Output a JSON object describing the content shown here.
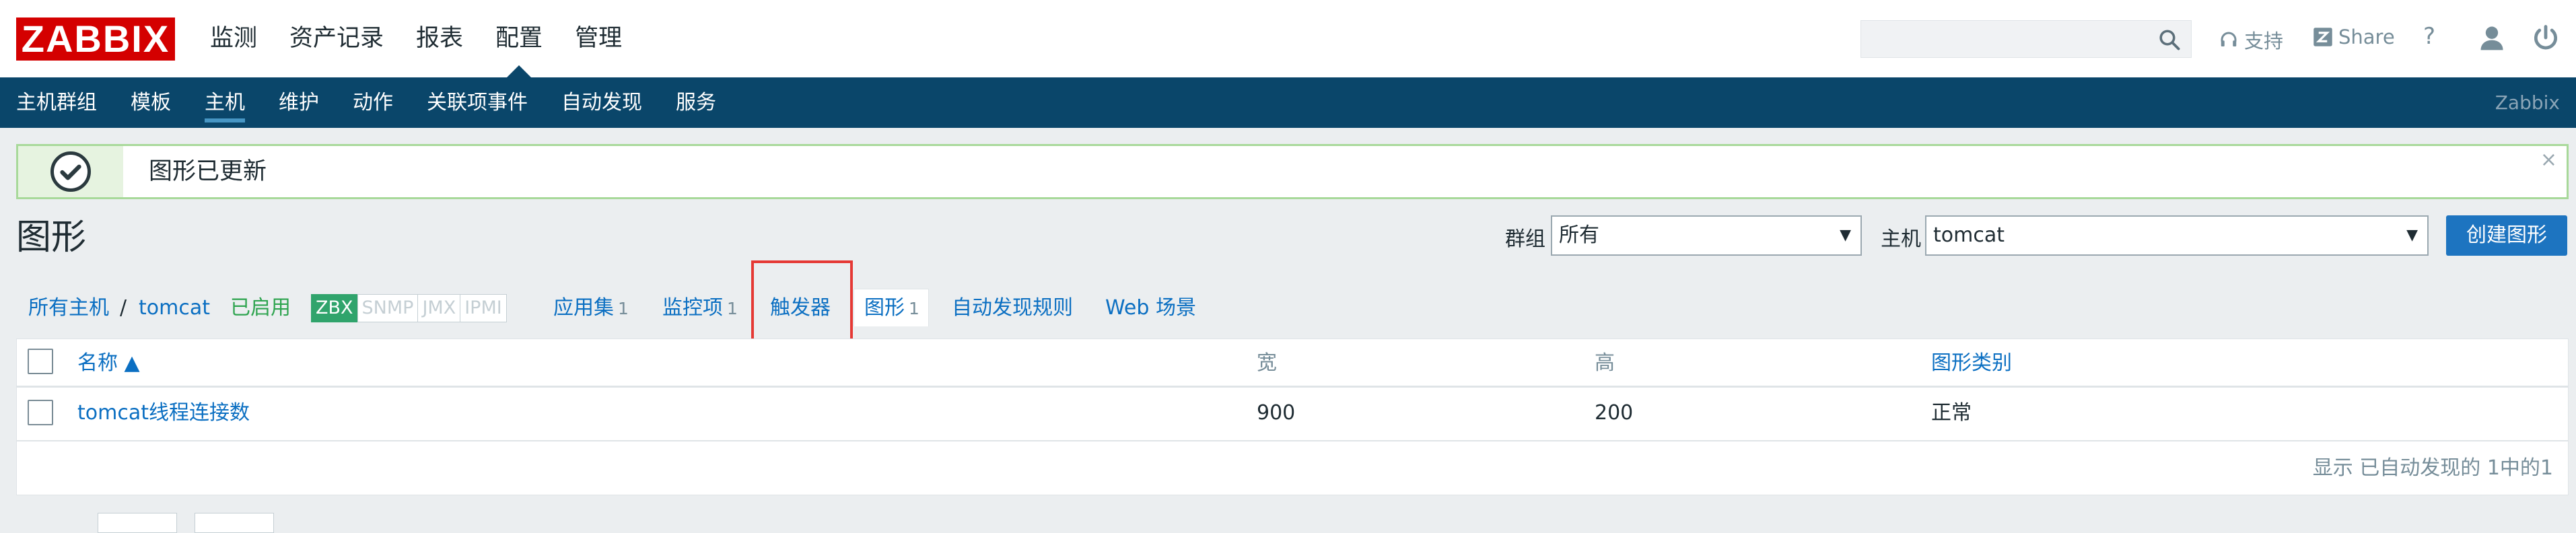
{
  "header": {
    "logo": "ZABBIX",
    "menu": [
      "监测",
      "资产记录",
      "报表",
      "配置",
      "管理"
    ],
    "active_menu": "配置",
    "search_placeholder": "",
    "support_label": "支持",
    "share_label": "Share",
    "help_label": "?"
  },
  "subnav": {
    "items": [
      "主机群组",
      "模板",
      "主机",
      "维护",
      "动作",
      "关联项事件",
      "自动发现",
      "服务"
    ],
    "active": "主机",
    "brand": "Zabbix"
  },
  "message": {
    "text": "图形已更新",
    "close": "×"
  },
  "page": {
    "title": "图形",
    "create_button": "创建图形"
  },
  "filter": {
    "group_label": "群组",
    "group_value": "所有",
    "host_label": "主机",
    "host_value": "tomcat"
  },
  "host_nav": {
    "all_hosts": "所有主机",
    "separator": "/",
    "host": "tomcat",
    "status": "已启用",
    "availability": [
      "ZBX",
      "SNMP",
      "JMX",
      "IPMI"
    ],
    "applications": {
      "label": "应用集",
      "count": "1"
    },
    "items": {
      "label": "监控项",
      "count": "1"
    },
    "triggers": {
      "label": "触发器"
    },
    "graphs": {
      "label": "图形",
      "count": "1"
    },
    "discovery": {
      "label": "自动发现规则"
    },
    "web": {
      "label": "Web 场景"
    }
  },
  "table": {
    "headers": {
      "name": "名称 ▲",
      "width": "宽",
      "height": "高",
      "type": "图形类别"
    },
    "rows": [
      {
        "name": "tomcat线程连接数",
        "width": "900",
        "height": "200",
        "type": "正常"
      }
    ],
    "footer": "显示 已自动发现的 1中的1"
  },
  "colors": {
    "header_bg": "#ffffff",
    "subnav_bg": "#0a466a",
    "link": "#0b6fc2",
    "logo_red": "#d40000",
    "success_border": "#a8d99a",
    "highlight_box": "#e53935",
    "button_blue": "#1d74c0"
  }
}
